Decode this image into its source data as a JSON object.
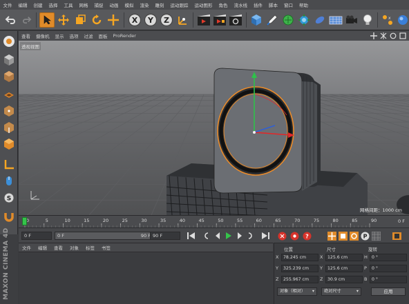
{
  "menu": [
    "文件",
    "编辑",
    "创建",
    "选择",
    "工具",
    "网格",
    "捕捉",
    "动画",
    "模拟",
    "渲染",
    "雕刻",
    "运动跟踪",
    "运动图形",
    "角色",
    "流水线",
    "插件",
    "脚本",
    "窗口",
    "帮助"
  ],
  "toolbar": {
    "axis_x": "X",
    "axis_y": "Y",
    "axis_z": "Z",
    "icons": [
      "undo-icon",
      "redo-icon",
      "select-arrow-icon",
      "move-icon",
      "scale-icon",
      "rotate-icon",
      "live-select-icon",
      "x-axis-lock-icon",
      "y-axis-lock-icon",
      "z-axis-lock-icon",
      "coordinate-system-icon",
      "render-view-icon",
      "render-picture-viewer-icon",
      "render-settings-icon",
      "cube-icon",
      "pen-icon",
      "subdivision-icon",
      "cloner-icon",
      "deformer-icon",
      "floor-icon",
      "camera-icon",
      "light-icon"
    ]
  },
  "viewport": {
    "menu": [
      "查看",
      "摄像机",
      "显示",
      "选项",
      "过滤",
      "面板",
      "ProRender"
    ],
    "label": "透视视图",
    "grid_info": "网格间距：1000 cm"
  },
  "timeline": {
    "ticks": [
      "0",
      "5",
      "10",
      "15",
      "20",
      "25",
      "30",
      "35",
      "40",
      "45",
      "50",
      "55",
      "60",
      "65",
      "70",
      "75",
      "80",
      "85",
      "90"
    ],
    "end_label": "0 F"
  },
  "playback": {
    "current_frame": "0 F",
    "range_start": "0 F",
    "range_end": "90 F",
    "max_frame": "90 F"
  },
  "objects": {
    "menu": [
      "文件",
      "编辑",
      "查看",
      "对象",
      "标签",
      "书签"
    ]
  },
  "coords": {
    "headers": [
      "位置",
      "尺寸",
      "旋转"
    ],
    "rows": [
      {
        "pos_label": "X",
        "pos": "78.245 cm",
        "size_label": "X",
        "size": "125.6 cm",
        "rot_label": "H",
        "rot": "0 °"
      },
      {
        "pos_label": "Y",
        "pos": "325.239 cm",
        "size_label": "Y",
        "size": "125.6 cm",
        "rot_label": "P",
        "rot": "0 °"
      },
      {
        "pos_label": "Z",
        "pos": "255.967 cm",
        "size_label": "Z",
        "size": "30.9 cm",
        "rot_label": "B",
        "rot": "0 °"
      }
    ],
    "mode": "对象（相对）",
    "size_mode": "绝对尺寸",
    "apply": "应用"
  },
  "brand": "MAXON CINEMA 4D",
  "colors": {
    "accent_orange": "#f5a623",
    "axis_x": "#e0282a",
    "axis_y": "#2ec24a",
    "axis_z": "#2f5fd6"
  }
}
